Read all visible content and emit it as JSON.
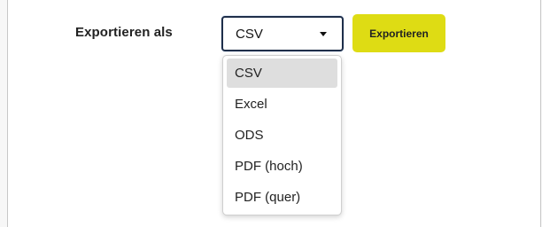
{
  "export": {
    "label": "Exportieren als",
    "selected_value": "CSV",
    "button_label": "Exportieren",
    "options": [
      "CSV",
      "Excel",
      "ODS",
      "PDF (hoch)",
      "PDF (quer)"
    ],
    "selected_index": 0
  },
  "colors": {
    "button_bg": "#dedc14",
    "select_border": "#1f2f4a",
    "highlight_bg": "#dedede"
  },
  "icons": {
    "select_caret": "caret-down-icon"
  }
}
